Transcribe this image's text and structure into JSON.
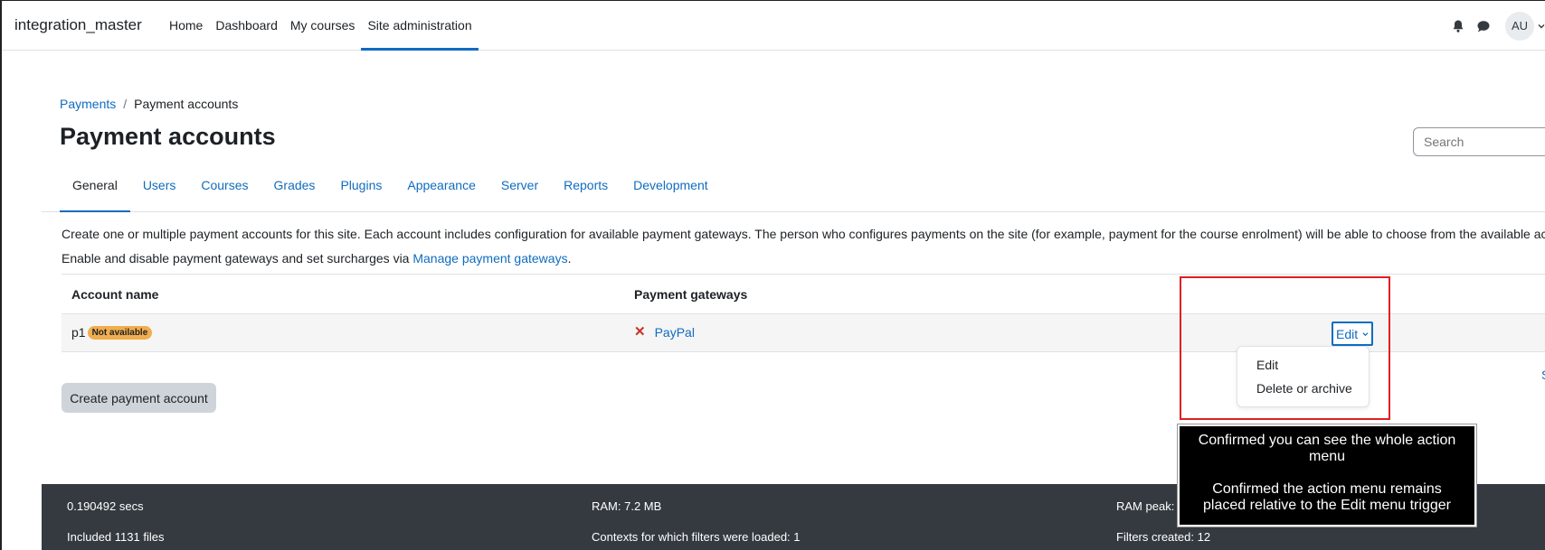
{
  "header": {
    "brand": "integration_master",
    "nav": [
      "Home",
      "Dashboard",
      "My courses",
      "Site administration"
    ],
    "avatar": "AU"
  },
  "breadcrumb": {
    "items": [
      "Payments",
      "Payment accounts"
    ]
  },
  "page_title": "Payment accounts",
  "search": {
    "placeholder": "Search"
  },
  "tabs": [
    "General",
    "Users",
    "Courses",
    "Grades",
    "Plugins",
    "Appearance",
    "Server",
    "Reports",
    "Development"
  ],
  "description": {
    "line1": "Create one or multiple payment accounts for this site. Each account includes configuration for available payment gateways. The person who configures payments on the site (for example, payment for the course enrolment) will be able to choose from the available accounts.",
    "line2_prefix": "Enable and disable payment gateways and set surcharges via ",
    "line2_link": "Manage payment gateways",
    "line2_suffix": "."
  },
  "table": {
    "headers": [
      "Account name",
      "Payment gateways"
    ],
    "rows": [
      {
        "name": "p1",
        "badge": "Not available",
        "gateway": "PayPal",
        "action": "Edit"
      }
    ]
  },
  "right_link": "S",
  "action_menu": [
    "Edit",
    "Delete or archive"
  ],
  "create_button": "Create payment account",
  "footer": {
    "col1": [
      "0.190492 secs",
      "Included 1131 files"
    ],
    "col2": [
      "RAM: 7.2 MB",
      "Contexts for which filters were loaded: 1"
    ],
    "col3": [
      "RAM peak:",
      "Filters created: 12"
    ]
  },
  "tooltip": {
    "line1": "Confirmed you can see the whole action menu",
    "line2": "Confirmed the action menu remains placed relative to the Edit menu trigger"
  },
  "colors": {
    "link": "#0f6cbf",
    "badge": "#f0ad4e",
    "footer": "#343a40",
    "highlight": "#e02020"
  }
}
